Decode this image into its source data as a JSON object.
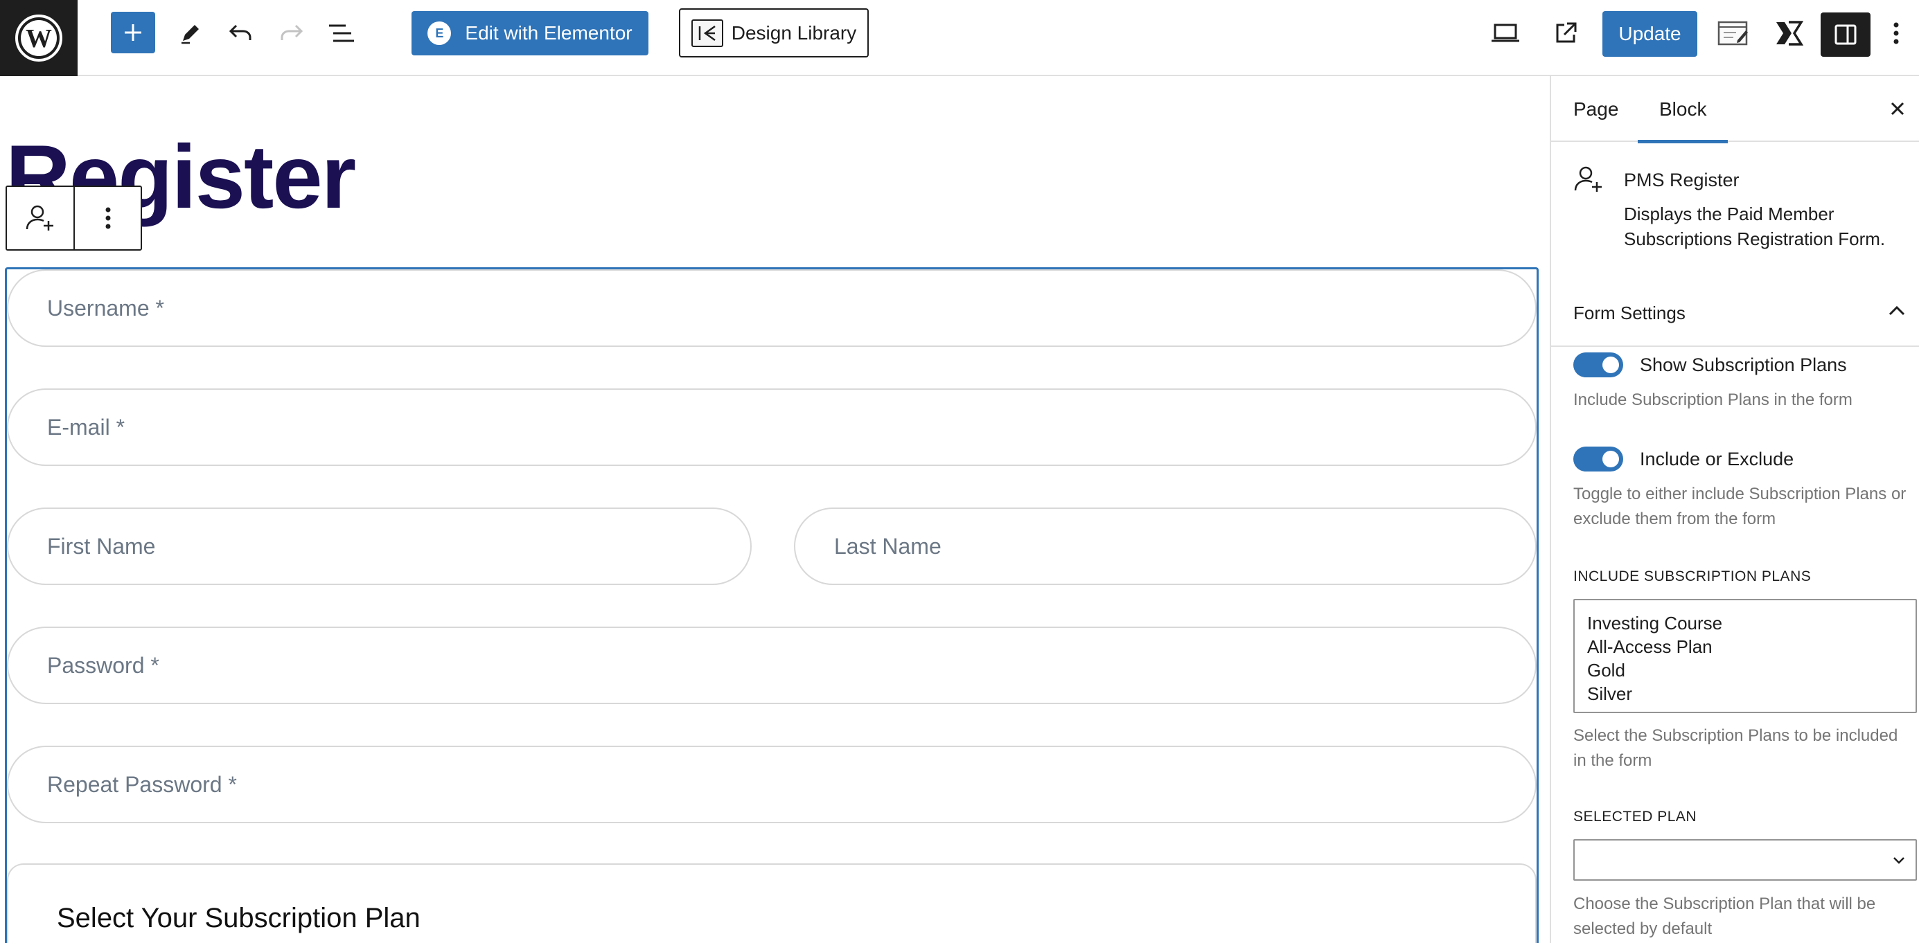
{
  "toolbar": {
    "edit_with_elementor": "Edit with Elementor",
    "design_library": "Design Library",
    "update": "Update",
    "elementor_badge": "E"
  },
  "page": {
    "title": "Register"
  },
  "form": {
    "fields": {
      "username": "Username *",
      "email": "E-mail *",
      "first_name": "First Name",
      "last_name": "Last Name",
      "password": "Password *",
      "repeat_password": "Repeat Password *"
    },
    "plan_section_heading": "Select Your Subscription Plan"
  },
  "sidebar": {
    "tabs": [
      "Page",
      "Block"
    ],
    "active_tab": "Block",
    "block": {
      "name": "PMS Register",
      "description": "Displays the Paid Member Subscriptions Registration Form."
    },
    "panel_title": "Form Settings",
    "show_plans": {
      "label": "Show Subscription Plans",
      "help": "Include Subscription Plans in the form",
      "enabled": true
    },
    "include_exclude": {
      "label": "Include or Exclude",
      "help": "Toggle to either include Subscription Plans or exclude them from the form",
      "enabled": true
    },
    "include_plans": {
      "label": "INCLUDE SUBSCRIPTION PLANS",
      "options": [
        "Investing Course",
        "All-Access Plan",
        "Gold",
        "Silver"
      ],
      "help": "Select the Subscription Plans to be included in the form"
    },
    "selected_plan": {
      "label": "SELECTED PLAN",
      "value": "",
      "help": "Choose the Subscription Plan that will be selected by default"
    }
  },
  "colors": {
    "accent": "#2f74b8",
    "title": "#1a1052",
    "dark": "#1e1e1e",
    "muted": "#757575"
  }
}
